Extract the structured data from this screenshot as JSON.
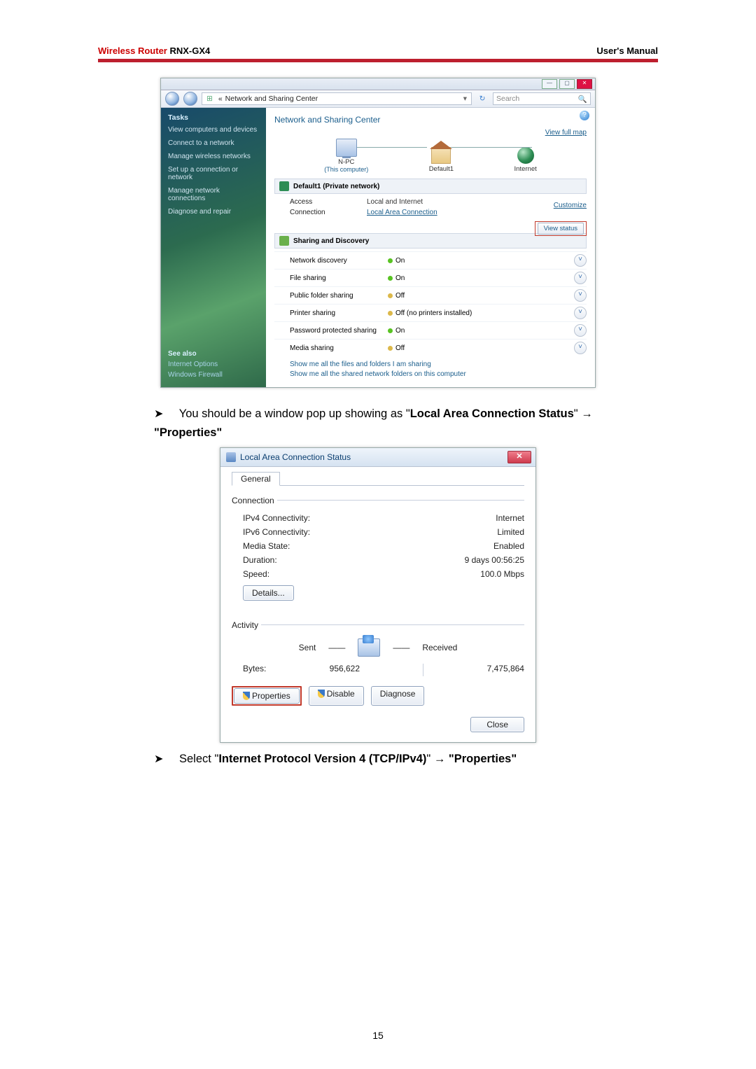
{
  "header": {
    "title_red": "Wireless Router",
    "title_black": " RNX-GX4",
    "right": "User's Manual"
  },
  "bullets": {
    "b1_pre": "You should be a window pop up showing as \"",
    "b1_bold1": "Local Area Connection Status",
    "b1_mid": "\" → ",
    "b1_bold2": "\"Properties\"",
    "b2_pre": "Select \"",
    "b2_bold1": "Internet Protocol Version 4 (TCP/IPv4)",
    "b2_mid": "\" → ",
    "b2_bold2": "\"Properties\""
  },
  "shot1": {
    "breadcrumb": "Network and Sharing Center",
    "search_placeholder": "Search",
    "help": "?",
    "tasks_header": "Tasks",
    "tasks": {
      "t0": "View computers and devices",
      "t1": "Connect to a network",
      "t2": "Manage wireless networks",
      "t3": "Set up a connection or network",
      "t4": "Manage network connections",
      "t5": "Diagnose and repair"
    },
    "seealso_header": "See also",
    "seealso": {
      "s0": "Internet Options",
      "s1": "Windows Firewall"
    },
    "main_heading": "Network and Sharing Center",
    "full_map": "View full map",
    "nodes": {
      "pc": "N-PC",
      "pc_sub": "(This computer)",
      "gw": "Default1",
      "inet": "Internet"
    },
    "net_section": {
      "title": "Default1",
      "title_paren": " (Private network)",
      "access_k": "Access",
      "access_v": "Local and Internet",
      "conn_k": "Connection",
      "conn_v": "Local Area Connection",
      "customize": "Customize",
      "view_status": "View status"
    },
    "sd_header": "Sharing and Discovery",
    "sd": {
      "r0_k": "Network discovery",
      "r0_v": "On",
      "r1_k": "File sharing",
      "r1_v": "On",
      "r2_k": "Public folder sharing",
      "r2_v": "Off",
      "r3_k": "Printer sharing",
      "r3_v": "Off (no printers installed)",
      "r4_k": "Password protected sharing",
      "r4_v": "On",
      "r5_k": "Media sharing",
      "r5_v": "Off"
    },
    "links": {
      "l0": "Show me all the files and folders I am sharing",
      "l1": "Show me all the shared network folders on this computer"
    }
  },
  "shot2": {
    "title": "Local Area Connection Status",
    "tab": "General",
    "conn_legend": "Connection",
    "conn": {
      "r0_k": "IPv4 Connectivity:",
      "r0_v": "Internet",
      "r1_k": "IPv6 Connectivity:",
      "r1_v": "Limited",
      "r2_k": "Media State:",
      "r2_v": "Enabled",
      "r3_k": "Duration:",
      "r3_v": "9 days 00:56:25",
      "r4_k": "Speed:",
      "r4_v": "100.0 Mbps"
    },
    "details_btn": "Details...",
    "act_legend": "Activity",
    "sent": "Sent",
    "received": "Received",
    "bytes_label": "Bytes:",
    "bytes_sent": "956,622",
    "bytes_recv": "7,475,864",
    "properties_btn": "Properties",
    "disable_btn": "Disable",
    "diagnose_btn": "Diagnose",
    "close_btn": "Close"
  },
  "page_number": "15"
}
